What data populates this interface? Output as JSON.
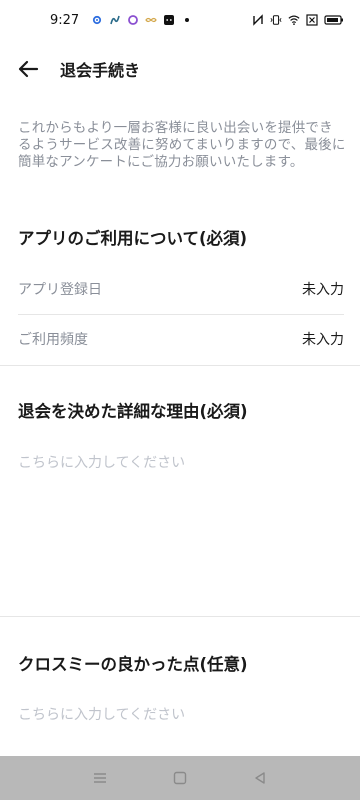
{
  "status_bar": {
    "time": "9:27",
    "left_icons": [
      "gear-icon",
      "swirl-icon",
      "circle-ring-icon",
      "infinity-icon",
      "cat-app-icon",
      "dot-icon"
    ],
    "right_icons": [
      "nfc-icon",
      "vibrate-icon",
      "wifi-icon",
      "x-box-icon",
      "battery-icon"
    ]
  },
  "app_bar": {
    "title": "退会手続き",
    "back_icon": "arrow-left-icon"
  },
  "intro": {
    "text": "これからもより一層お客様に良い出会いを提供できるようサービス改善に努めてまいりますので、最後に簡単なアンケートにご協力お願いいたします。"
  },
  "section_usage": {
    "title": "アプリのご利用について(必須)",
    "rows": [
      {
        "label": "アプリ登録日",
        "value": "未入力"
      },
      {
        "label": "ご利用頻度",
        "value": "未入力"
      }
    ]
  },
  "section_reason": {
    "title": "退会を決めた詳細な理由(必須)",
    "placeholder": "こちらに入力してください",
    "value": ""
  },
  "section_good_points": {
    "title": "クロスミーの良かった点(任意)",
    "placeholder": "こちらに入力してください",
    "value": ""
  },
  "nav_bar": {
    "buttons": [
      "menu-icon",
      "home-square-icon",
      "back-triangle-icon"
    ]
  },
  "colors": {
    "primary_text": "#1a1a1a",
    "secondary_text": "#8a8f99",
    "placeholder": "#c0c4cc",
    "divider": "#e6e6e6",
    "nav_bar": "#b8b8b8"
  }
}
